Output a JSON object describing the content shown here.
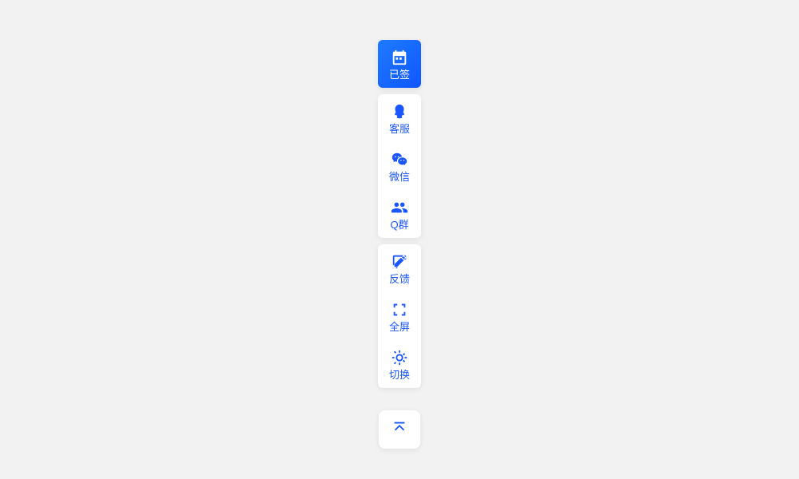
{
  "toolbar": {
    "signed": {
      "label": "已签"
    },
    "contact": [
      {
        "label": "客服"
      },
      {
        "label": "微信"
      },
      {
        "label": "Q群"
      }
    ],
    "tools": [
      {
        "label": "反馈"
      },
      {
        "label": "全屏"
      },
      {
        "label": "切换"
      }
    ]
  },
  "colors": {
    "primary": "#1a56ff"
  }
}
